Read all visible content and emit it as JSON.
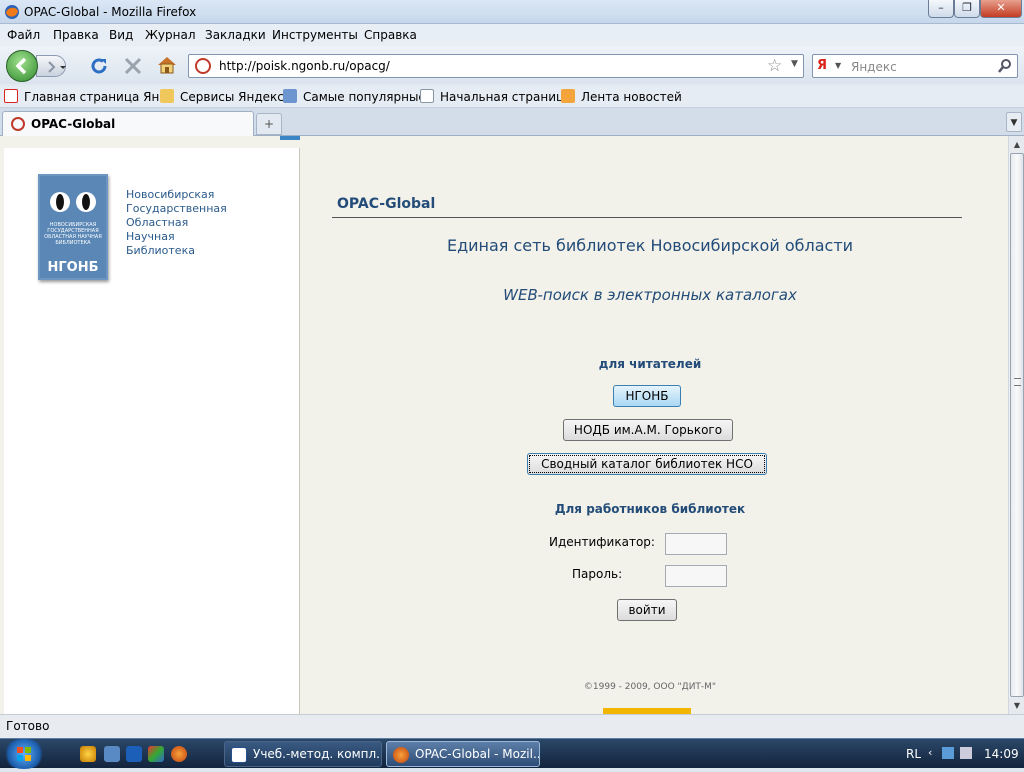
{
  "window": {
    "title": "OPAC-Global - Mozilla Firefox"
  },
  "menu": [
    "Файл",
    "Правка",
    "Вид",
    "Журнал",
    "Закладки",
    "Инструменты",
    "Справка"
  ],
  "nav": {
    "url": "http://poisk.ngonb.ru/opacg/",
    "search_placeholder": "Яндекс"
  },
  "bookmarks": [
    "Главная страница Ян...",
    "Сервисы Яндекса",
    "Самые популярные",
    "Начальная страница",
    "Лента новостей"
  ],
  "tabs": [
    {
      "label": "OPAC-Global"
    }
  ],
  "page": {
    "logo_text": "НОВОСИБИРСКАЯ ГОСУДАРСТВЕННАЯ ОБЛАСТНАЯ НАУЧНАЯ БИБЛИОТЕКА",
    "logo_abbr": "НГОНБ",
    "library_name": [
      "Новосибирская",
      "Государственная",
      "Областная",
      "Научная",
      "Библиотека"
    ],
    "header": "OPAC-Global",
    "title": "Единая сеть библиотек Новосибирской области",
    "subtitle": "WEB-поиск в электронных каталогах",
    "readers_heading": "для читателей",
    "buttons": [
      "НГОНБ",
      "НОДБ им.А.М. Горького",
      "Сводный каталог библиотек НСО"
    ],
    "staff_heading": "Для работников библиотек",
    "id_label": "Идентификатор:",
    "password_label": "Пароль:",
    "login_button": "войти",
    "copyright": "©1999 - 2009, ООО \"ДИТ-М\""
  },
  "status": "Готово",
  "taskbar": {
    "tasks": [
      "Учеб.-метод. компл...",
      "OPAC-Global - Mozil..."
    ],
    "lang": "RL",
    "time": "14:09"
  }
}
